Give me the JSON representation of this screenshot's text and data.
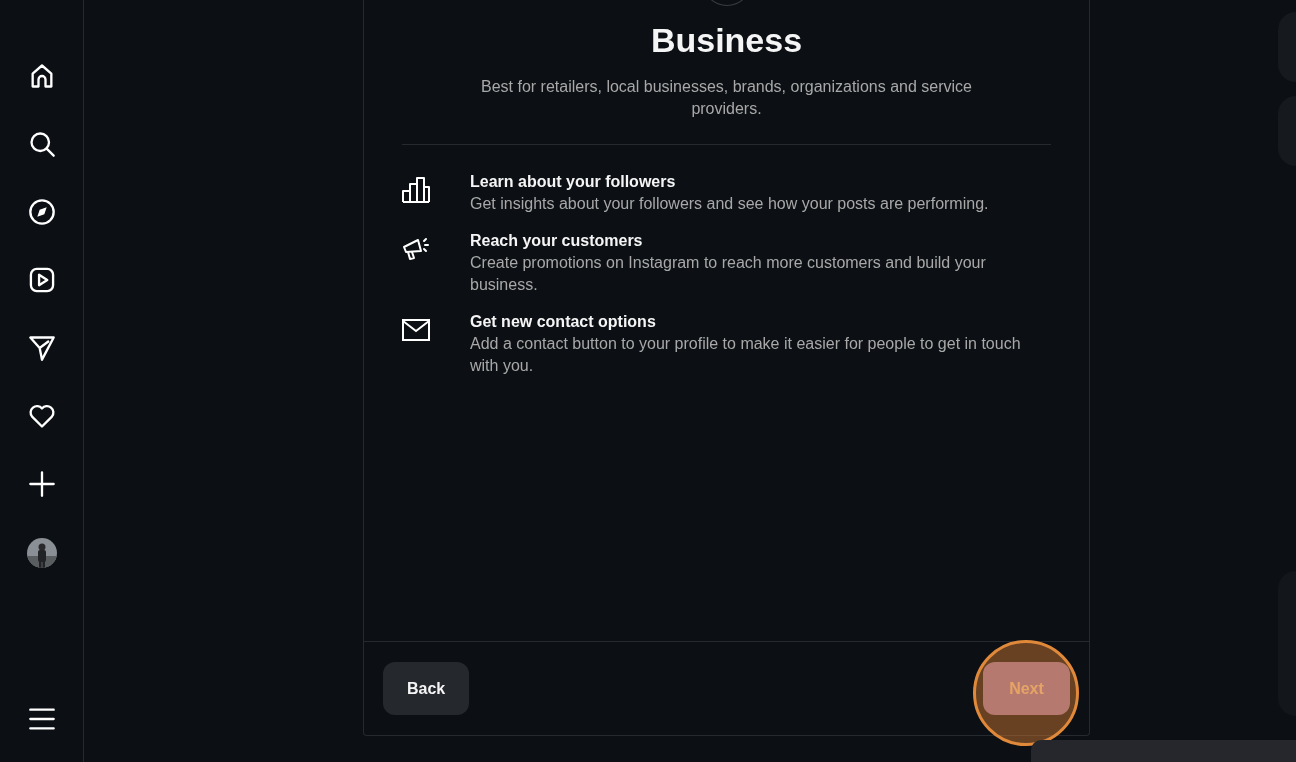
{
  "dialog": {
    "title": "Business",
    "description": "Best for retailers, local businesses, brands, organizations and service providers.",
    "features": [
      {
        "kind": "chart",
        "title": "Learn about your followers",
        "text": "Get insights about your followers and see how your posts are performing."
      },
      {
        "kind": "megaphone",
        "title": "Reach your customers",
        "text": "Create promotions on Instagram to reach more customers and build your business."
      },
      {
        "kind": "mail",
        "title": "Get new contact options",
        "text": "Add a contact button to your profile to make it easier for people to get in touch with you."
      }
    ],
    "buttons": [
      {
        "label": "Back",
        "kind": "secondary",
        "highlighted": false
      },
      {
        "label": "Next",
        "kind": "primary",
        "highlighted": true
      }
    ]
  }
}
